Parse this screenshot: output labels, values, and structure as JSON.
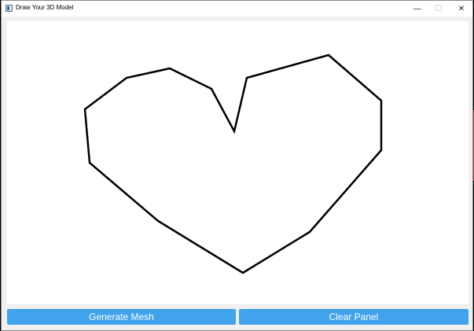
{
  "window": {
    "title": "Draw Your 3D Model",
    "app_icon": "app-window-icon",
    "controls": {
      "minimize_glyph": "—",
      "maximize_glyph": "☐",
      "close_glyph": "✕"
    }
  },
  "canvas": {
    "stroke_color": "#000000",
    "background": "#ffffff"
  },
  "buttons": {
    "generate_label": "Generate Mesh",
    "clear_label": "Clear Panel",
    "color": "#40a3ec"
  }
}
